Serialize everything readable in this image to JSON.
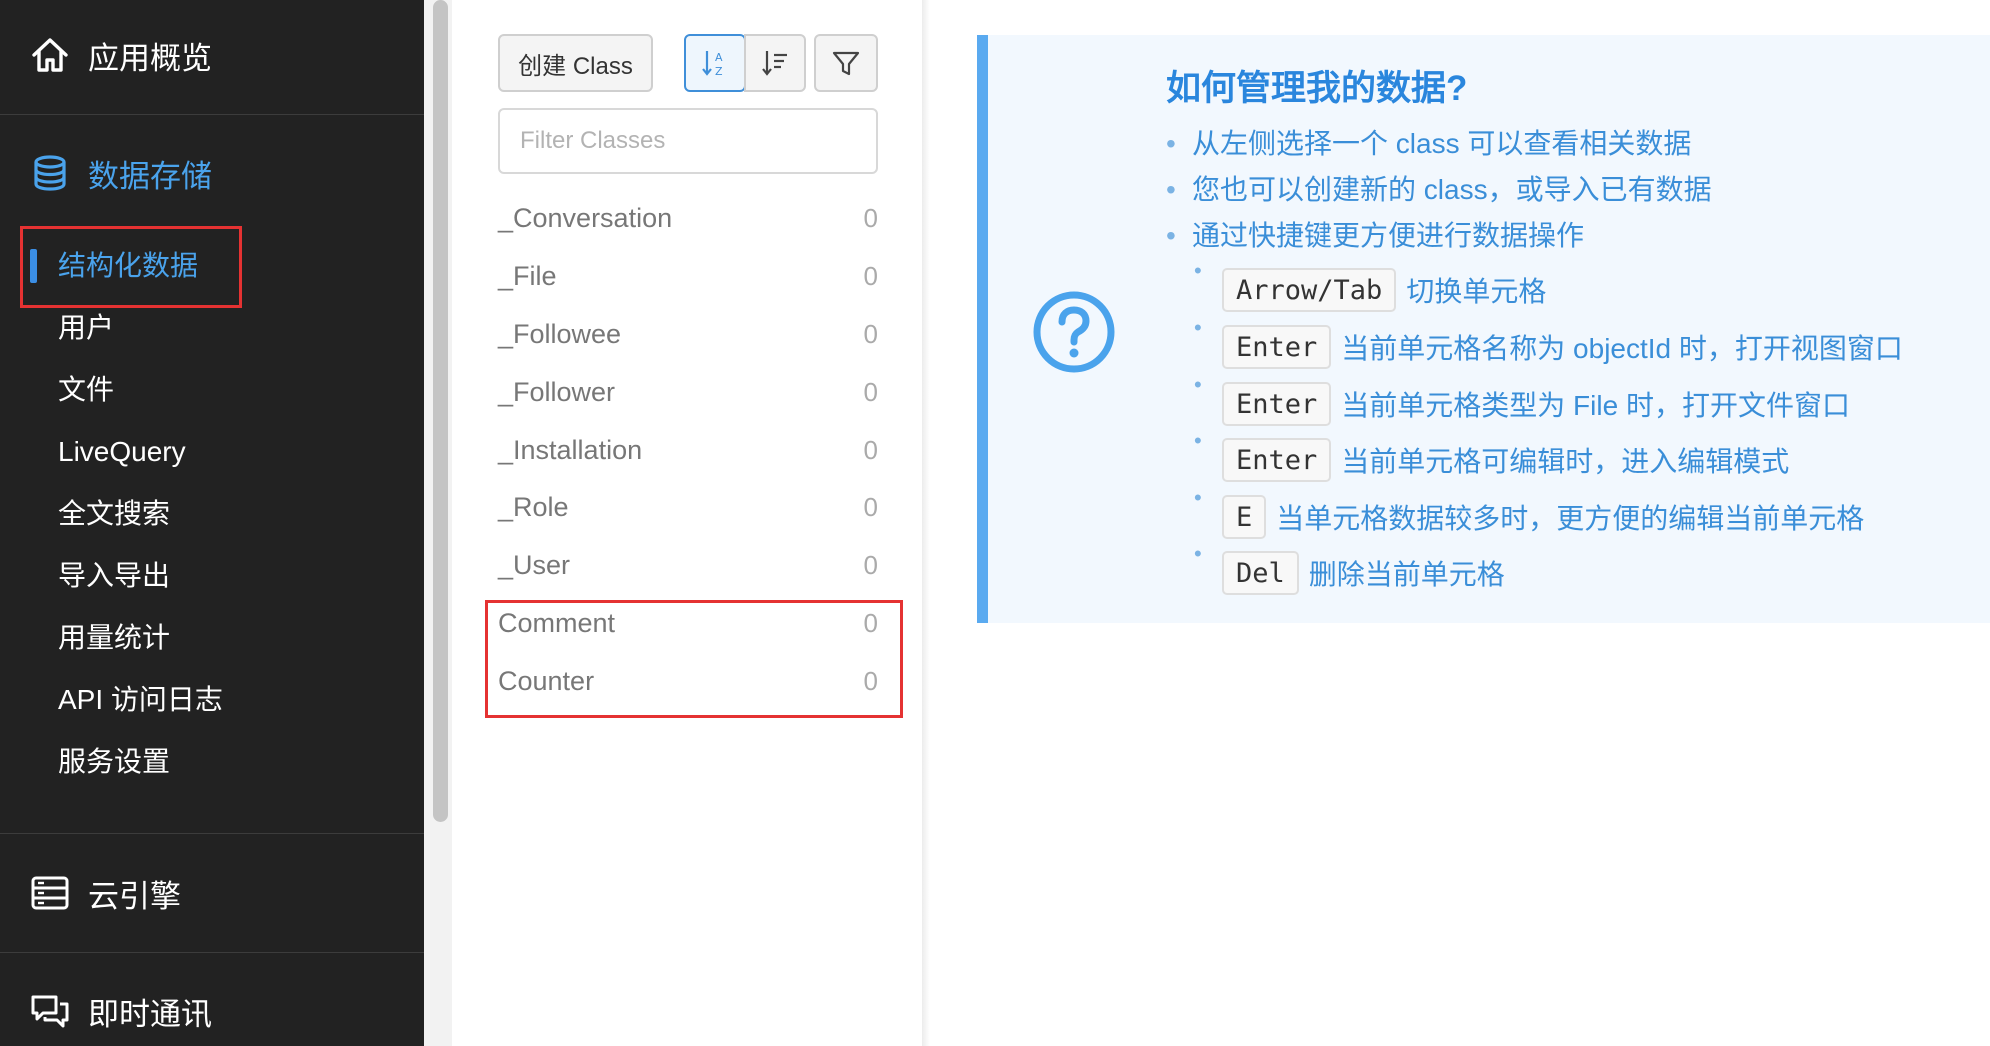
{
  "sidebar": {
    "sections": [
      {
        "label": "应用概览",
        "icon": "home-icon"
      },
      {
        "label": "数据存储",
        "icon": "database-icon"
      },
      {
        "label": "云引擎",
        "icon": "server-icon"
      },
      {
        "label": "即时通讯",
        "icon": "chat-icon"
      }
    ],
    "storage_items": [
      {
        "label": "结构化数据"
      },
      {
        "label": "用户"
      },
      {
        "label": "文件"
      },
      {
        "label": "LiveQuery"
      },
      {
        "label": "全文搜索"
      },
      {
        "label": "导入导出"
      },
      {
        "label": "用量统计"
      },
      {
        "label": "API 访问日志"
      },
      {
        "label": "服务设置"
      }
    ],
    "active_item": "结构化数据"
  },
  "class_panel": {
    "create_button": "创建 Class",
    "sort_buttons": [
      "sort-alpha-icon",
      "sort-list-icon"
    ],
    "filter_icon": "filter-icon",
    "filter_placeholder": "Filter Classes",
    "classes": [
      {
        "name": "_Conversation",
        "count": "0"
      },
      {
        "name": "_File",
        "count": "0"
      },
      {
        "name": "_Followee",
        "count": "0"
      },
      {
        "name": "_Follower",
        "count": "0"
      },
      {
        "name": "_Installation",
        "count": "0"
      },
      {
        "name": "_Role",
        "count": "0"
      },
      {
        "name": "_User",
        "count": "0"
      },
      {
        "name": "Comment",
        "count": "0"
      },
      {
        "name": "Counter",
        "count": "0"
      }
    ]
  },
  "help": {
    "icon": "question-circle-icon",
    "title": "如何管理我的数据?",
    "tips": [
      "从左侧选择一个 class 可以查看相关数据",
      "您也可以创建新的 class，或导入已有数据",
      "通过快捷键更方便进行数据操作"
    ],
    "shortcuts": [
      {
        "key": "Arrow/Tab",
        "desc": "切换单元格"
      },
      {
        "key": "Enter",
        "desc": "当前单元格名称为 objectId 时，打开视图窗口"
      },
      {
        "key": "Enter",
        "desc": "当前单元格类型为 File 时，打开文件窗口"
      },
      {
        "key": "Enter",
        "desc": "当前单元格可编辑时，进入编辑模式"
      },
      {
        "key": "E",
        "desc": "当单元格数据较多时，更方便的编辑当前单元格"
      },
      {
        "key": "Del",
        "desc": "删除当前单元格"
      }
    ]
  },
  "colors": {
    "sidebar_bg": "#222222",
    "accent": "#4aa3ec",
    "highlight_box": "#e53232",
    "help_bg": "#f2f8fe",
    "help_border": "#5aaaf0"
  }
}
